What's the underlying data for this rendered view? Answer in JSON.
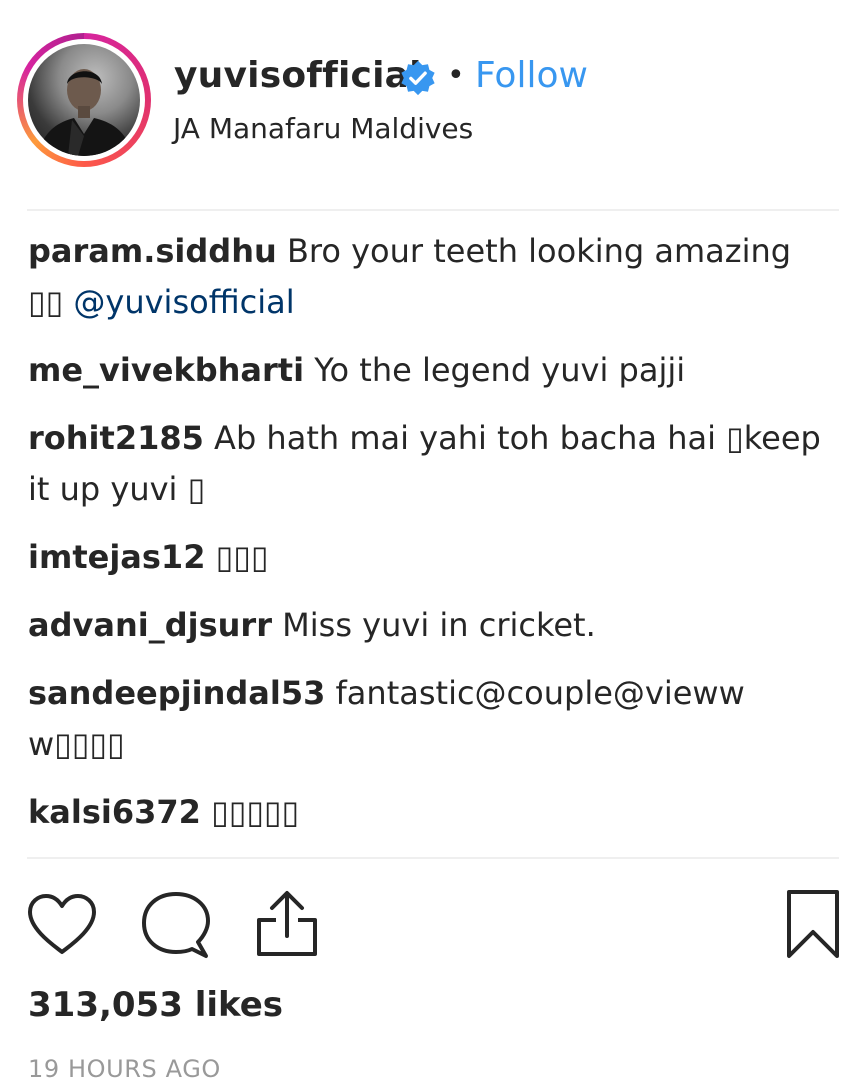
{
  "header": {
    "username": "yuvisofficial",
    "separator": "•",
    "follow_label": "Follow",
    "location": "JA Manafaru Maldives",
    "verified_icon": "verified-badge-icon",
    "accent_color": "#3897f0"
  },
  "comments": [
    {
      "user": "param.siddhu",
      "text": " Bro your teeth looking amazing ▯▯ ",
      "mention": "@yuvisofficial"
    },
    {
      "user": "me_vivekbharti",
      "text": " Yo the legend yuvi pajji",
      "mention": ""
    },
    {
      "user": "rohit2185",
      "text": " Ab hath mai yahi toh bacha hai ▯keep it up yuvi ▯",
      "mention": ""
    },
    {
      "user": "imtejas12",
      "text": " ▯▯▯",
      "mention": ""
    },
    {
      "user": "advani_djsurr",
      "text": " Miss yuvi in cricket.",
      "mention": ""
    },
    {
      "user": "sandeepjindal53",
      "text": " fantastic@couple@vieww w▯▯▯▯",
      "mention": ""
    },
    {
      "user": "kalsi6372",
      "text": " ▯▯▯▯▯",
      "mention": ""
    }
  ],
  "actions": {
    "like_icon": "heart-icon",
    "comment_icon": "comment-icon",
    "share_icon": "share-icon",
    "save_icon": "bookmark-icon"
  },
  "likes": "313,053 likes",
  "timestamp": "19 HOURS AGO"
}
